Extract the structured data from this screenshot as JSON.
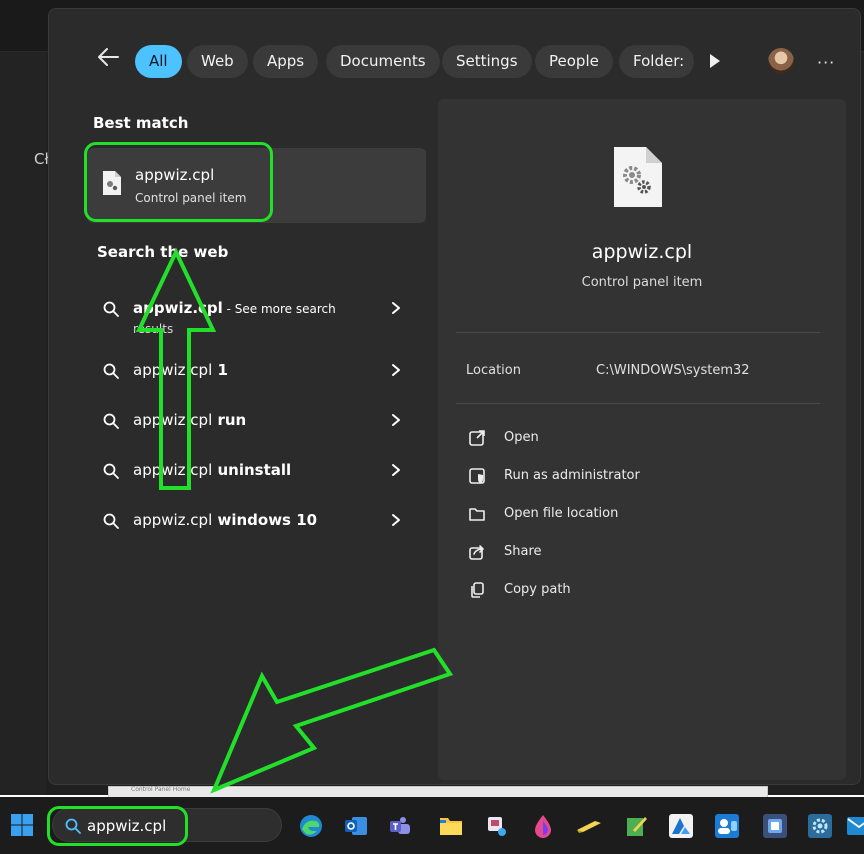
{
  "background": {
    "fragment_text": "Cł"
  },
  "filters": {
    "back_label": "back",
    "chips": [
      {
        "label": "All",
        "active": true
      },
      {
        "label": "Web",
        "active": false
      },
      {
        "label": "Apps",
        "active": false
      },
      {
        "label": "Documents",
        "active": false
      },
      {
        "label": "Settings",
        "active": false
      },
      {
        "label": "People",
        "active": false
      },
      {
        "label": "Folder:",
        "active": false
      }
    ],
    "more_label": "···"
  },
  "results": {
    "best_match_title": "Best match",
    "best_match": {
      "name": "appwiz.cpl",
      "type": "Control panel item"
    },
    "web_title": "Search the web",
    "web_items": [
      {
        "query": "appwiz.cpl",
        "suffix": " - See more search",
        "sub": "results"
      },
      {
        "prefix": "appwiz.cpl",
        "bold": " 1"
      },
      {
        "prefix": "appwiz.cpl",
        "bold": " run"
      },
      {
        "prefix": "appwiz.cpl",
        "bold": " uninstall"
      },
      {
        "prefix": "appwiz.cpl",
        "bold": " windows 10"
      }
    ]
  },
  "detail": {
    "name": "appwiz.cpl",
    "type": "Control panel item",
    "location_label": "Location",
    "location_value": "C:\\WINDOWS\\system32",
    "actions": [
      {
        "label": "Open",
        "icon": "open-external-icon"
      },
      {
        "label": "Run as administrator",
        "icon": "shield-admin-icon"
      },
      {
        "label": "Open file location",
        "icon": "folder-icon"
      },
      {
        "label": "Share",
        "icon": "share-icon"
      },
      {
        "label": "Copy path",
        "icon": "copy-icon"
      }
    ]
  },
  "taskbar": {
    "strip_text": "Control Panel Home",
    "search_value": "appwiz.cpl",
    "apps": [
      "browser-app-icon",
      "outlook-app-icon",
      "teams-app-icon",
      "file-explorer-app-icon",
      "snip-app-icon",
      "paint-app-icon",
      "pen-app-icon",
      "notes-app-icon",
      "azure-app-icon",
      "people-app-icon",
      "store-app-icon",
      "settings-app-icon",
      "mail-app-icon"
    ]
  },
  "colors": {
    "accent": "#4cc2ff",
    "annotation": "#22e02a",
    "panel": "#2b2b2b",
    "detail": "#333333"
  }
}
